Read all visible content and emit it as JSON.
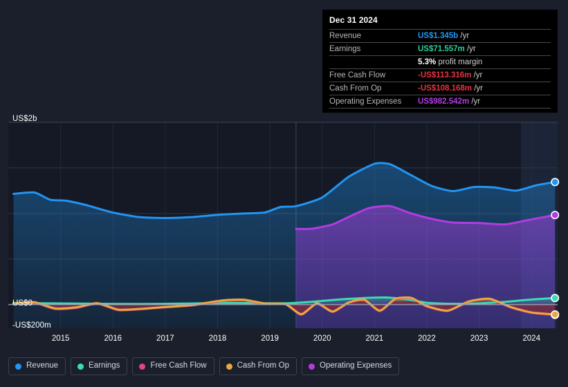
{
  "theme": {
    "background": "#1a1f2b",
    "plot_background": "#141925",
    "gridline": "#2e3545",
    "zero_line": "#9aa4b5",
    "forecast_band": "#1d2636",
    "tooltip_background": "#000000",
    "axis_text": "#ffffff"
  },
  "axes": {
    "y_labels": [
      {
        "text": "US$2b",
        "value": 2000,
        "y": 166
      },
      {
        "text": "US$0",
        "value": 0,
        "y": 433
      },
      {
        "text": "-US$200m",
        "value": -200,
        "y": 465
      }
    ],
    "x_labels": [
      "2015",
      "2016",
      "2017",
      "2018",
      "2019",
      "2020",
      "2021",
      "2022",
      "2023",
      "2024"
    ]
  },
  "tooltip": {
    "date": "Dec 31 2024",
    "rows": [
      {
        "key": "Revenue",
        "value": "US$1.345b",
        "suffix": "/yr",
        "color": "#2196f3"
      },
      {
        "key": "Earnings",
        "value": "US$71.557m",
        "suffix": "/yr",
        "color": "#2ecc9b"
      },
      {
        "key": "",
        "value": "5.3%",
        "suffix": "profit margin",
        "color": "#ffffff"
      },
      {
        "key": "Free Cash Flow",
        "value": "-US$113.316m",
        "suffix": "/yr",
        "color": "#e8343f"
      },
      {
        "key": "Cash From Op",
        "value": "-US$108.168m",
        "suffix": "/yr",
        "color": "#e8343f"
      },
      {
        "key": "Operating Expenses",
        "value": "US$982.542m",
        "suffix": "/yr",
        "color": "#b23ce0"
      }
    ]
  },
  "legend": {
    "items": [
      {
        "label": "Revenue",
        "color": "#2196f3"
      },
      {
        "label": "Earnings",
        "color": "#3ddbb4"
      },
      {
        "label": "Free Cash Flow",
        "color": "#e0477e"
      },
      {
        "label": "Cash From Op",
        "color": "#eba73f"
      },
      {
        "label": "Operating Expenses",
        "color": "#b23ce0"
      }
    ]
  },
  "chart_data": {
    "type": "area",
    "title": "",
    "xlabel": "",
    "ylabel": "",
    "x_unit": "year",
    "xlim": [
      2014.5,
      2025.0
    ],
    "ylim": [
      -260,
      2000
    ],
    "y_unit": "US$ millions",
    "grid": true,
    "legend_position": "bottom",
    "zero_line": 0,
    "forecast_start": 2024.3,
    "annotation_line": 2020.0,
    "series": [
      {
        "name": "Revenue",
        "color": "#2196f3",
        "x": [
          2014.6,
          2015.0,
          2015.3,
          2015.6,
          2016.0,
          2016.5,
          2017.0,
          2017.5,
          2018.0,
          2018.5,
          2019.0,
          2019.4,
          2019.7,
          2020.0,
          2020.5,
          2021.0,
          2021.5,
          2021.8,
          2022.2,
          2022.6,
          2023.0,
          2023.4,
          2023.8,
          2024.2,
          2024.6,
          2024.95
        ],
        "y": [
          1215,
          1230,
          1150,
          1140,
          1090,
          1010,
          960,
          950,
          960,
          985,
          1000,
          1010,
          1070,
          1080,
          1175,
          1400,
          1545,
          1540,
          1420,
          1300,
          1245,
          1290,
          1285,
          1250,
          1310,
          1345
        ]
      },
      {
        "name": "Earnings",
        "color": "#3ddbb4",
        "x": [
          2014.6,
          2015.2,
          2016.0,
          2017.0,
          2018.0,
          2018.6,
          2019.2,
          2019.8,
          2020.3,
          2020.8,
          2021.3,
          2021.7,
          2022.1,
          2022.5,
          2023.0,
          2023.5,
          2024.0,
          2024.5,
          2024.95
        ],
        "y": [
          18,
          14,
          10,
          6,
          12,
          18,
          16,
          14,
          30,
          55,
          72,
          78,
          60,
          20,
          8,
          14,
          30,
          56,
          71.557
        ]
      },
      {
        "name": "Free Cash Flow",
        "color": "#e0477e",
        "x": [
          2014.6,
          2015.0,
          2015.4,
          2015.8,
          2016.2,
          2016.6,
          2017.0,
          2017.5,
          2018.0,
          2018.6,
          2019.0,
          2019.4,
          2019.8,
          2020.1,
          2020.4,
          2020.7,
          2021.0,
          2021.3,
          2021.6,
          2021.9,
          2022.2,
          2022.5,
          2022.9,
          2023.3,
          2023.7,
          2024.1,
          2024.5,
          2024.95
        ],
        "y": [
          8,
          20,
          -48,
          -36,
          10,
          -60,
          -52,
          -30,
          -10,
          40,
          48,
          8,
          2,
          -110,
          10,
          -80,
          18,
          50,
          -70,
          60,
          70,
          -20,
          -70,
          30,
          60,
          -30,
          -90,
          -113.316
        ]
      },
      {
        "name": "Cash From Op",
        "color": "#eba73f",
        "x": [
          2014.6,
          2015.0,
          2015.4,
          2015.8,
          2016.2,
          2016.6,
          2017.0,
          2017.5,
          2018.0,
          2018.6,
          2019.0,
          2019.4,
          2019.8,
          2020.1,
          2020.4,
          2020.7,
          2021.0,
          2021.3,
          2021.6,
          2021.9,
          2022.2,
          2022.5,
          2022.9,
          2023.3,
          2023.7,
          2024.1,
          2024.5,
          2024.95
        ],
        "y": [
          12,
          26,
          -42,
          -30,
          16,
          -55,
          -48,
          -26,
          -5,
          46,
          54,
          12,
          6,
          -105,
          14,
          -76,
          22,
          55,
          -66,
          64,
          74,
          -16,
          -66,
          34,
          64,
          -26,
          -86,
          -108.168
        ]
      },
      {
        "name": "Operating Expenses",
        "color": "#b23ce0",
        "x": [
          2020.0,
          2020.3,
          2020.7,
          2021.0,
          2021.4,
          2021.8,
          2022.2,
          2022.6,
          2023.0,
          2023.5,
          2024.0,
          2024.5,
          2024.95
        ],
        "y": [
          830,
          832,
          880,
          960,
          1060,
          1080,
          1000,
          940,
          900,
          895,
          880,
          935,
          982.542
        ]
      }
    ]
  }
}
